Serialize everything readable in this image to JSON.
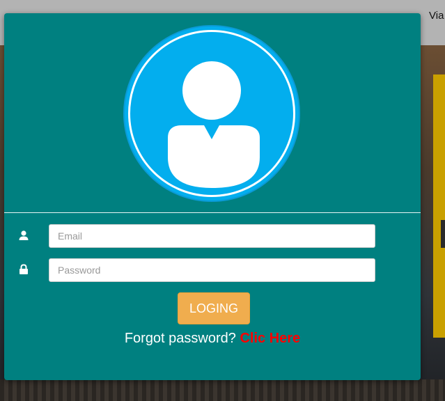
{
  "background": {
    "header_text": "Via"
  },
  "modal": {
    "email_placeholder": "Email",
    "password_placeholder": "Password",
    "login_label": "LOGING",
    "forgot_text": "Forgot password?",
    "forgot_link": "Clic Here",
    "icons": {
      "avatar": "user-avatar-icon",
      "email": "user-icon",
      "password": "lock-icon"
    }
  },
  "colors": {
    "modal_bg": "#008080",
    "avatar_bg": "#03aeee",
    "button_bg": "#f0ad4e",
    "link": "#ff0000"
  }
}
